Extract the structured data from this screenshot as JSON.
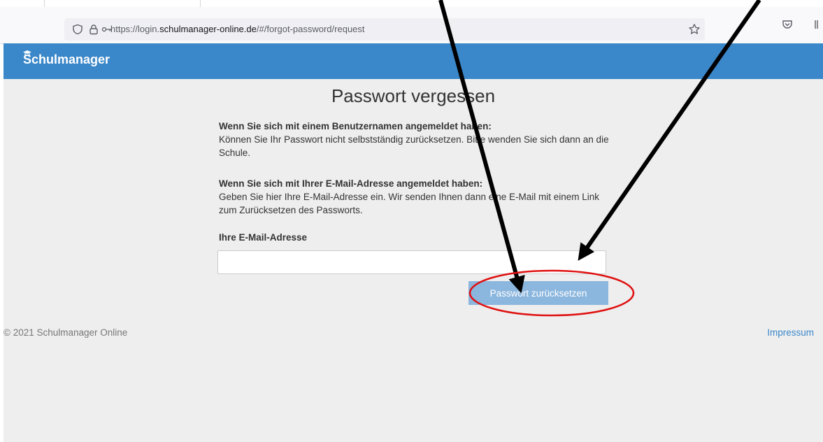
{
  "browser": {
    "url_prefix": "https://login.",
    "url_domain": "schulmanager-online.de",
    "url_path": "/#/forgot-password/request",
    "icons": [
      "shield-icon",
      "lock-icon",
      "key-icon",
      "bookmark-star-icon",
      "pocket-icon",
      "library-icon"
    ]
  },
  "header": {
    "brand": "Schulmanager",
    "color": "#3a87c9"
  },
  "page": {
    "title": "Passwort vergessen",
    "username_heading": "Wenn Sie sich mit einem Benutzernamen angemeldet haben:",
    "username_text": "Können Sie Ihr Passwort nicht selbstständig zurücksetzen. Bitte wenden Sie sich dann an die Schule.",
    "email_heading": "Wenn Sie sich mit Ihrer E-Mail-Adresse angemeldet haben:",
    "email_text": "Geben Sie hier Ihre E-Mail-Adresse ein. Wir senden Ihnen dann eine E-Mail mit einem Link zum Zurücksetzen des Passworts.",
    "email_label": "Ihre E-Mail-Adresse",
    "email_value": "",
    "submit_label": "Passwort zurücksetzen",
    "submit_color": "#8bb6de"
  },
  "footer": {
    "copyright": "© 2021 Schulmanager Online",
    "impressum": "Impressum"
  },
  "annotations": {
    "arrow_color": "#000000",
    "circle_color": "#e01010"
  }
}
